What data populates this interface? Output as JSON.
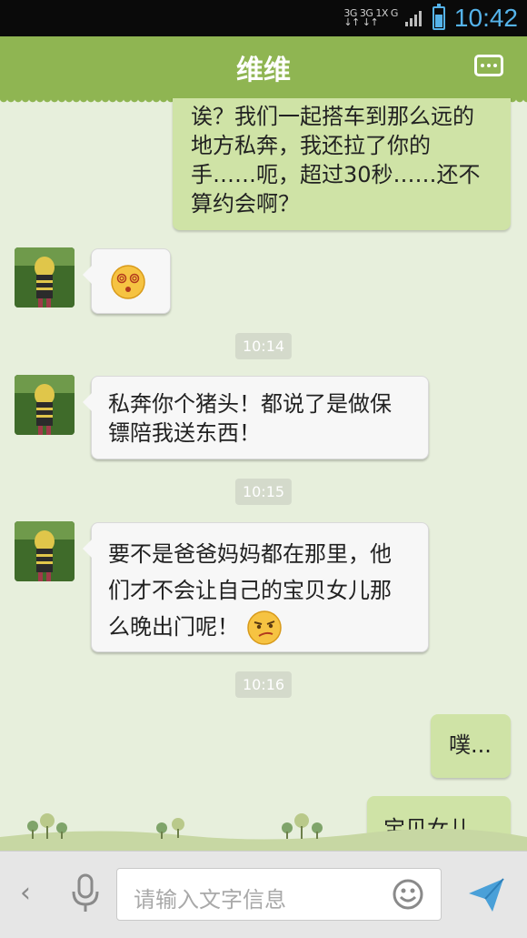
{
  "status": {
    "net_top": "3G 3G 1X G",
    "net_bottom": "↓↑ ↓↑ ",
    "time": "10:42"
  },
  "header": {
    "title": "维维",
    "menu_icon": "more-dots-icon"
  },
  "messages": [
    {
      "side": "out",
      "text": "诶？我们一起搭车到那么远的地方私奔，我还拉了你的手……呃，超过30秒……还不算约会啊？"
    },
    {
      "side": "in",
      "emoji": "dizzy-face-emoji"
    },
    {
      "time": "10:14"
    },
    {
      "side": "in",
      "text": "私奔你个猪头！都说了是做保镖陪我送东西！"
    },
    {
      "time": "10:15"
    },
    {
      "side": "in",
      "text": "要不是爸爸妈妈都在那里，他们才不会让自己的宝贝女儿那么晚出门呢！",
      "emoji": "smirk-emoji"
    },
    {
      "time": "10:16"
    },
    {
      "side": "out",
      "text": "噗..."
    },
    {
      "side": "out",
      "text": "宝贝女儿..."
    }
  ],
  "input": {
    "placeholder": "请输入文字信息"
  },
  "colors": {
    "header": "#8fb552",
    "out_bubble": "#cfe3a6",
    "in_bubble": "#f7f7f7",
    "time_accent": "#55b3ea",
    "background": "#e7efdc"
  }
}
